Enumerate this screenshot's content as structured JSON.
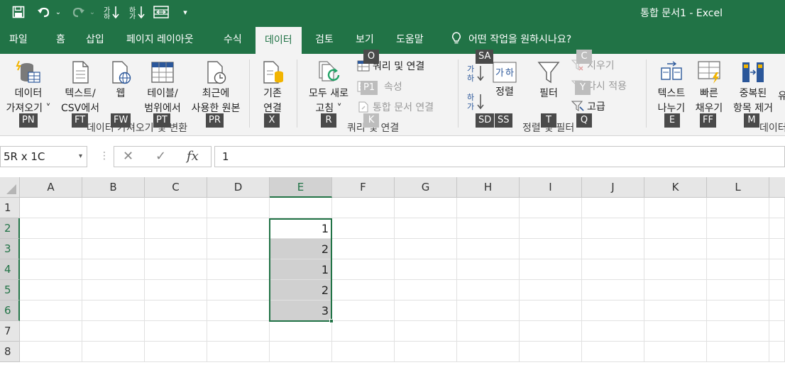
{
  "window": {
    "title": "통합 문서1  -  Excel"
  },
  "colors": {
    "accent": "#217346",
    "ribbon_bg": "#f3f3f3",
    "selection_fill": "#d0d0d0"
  },
  "qat": {
    "save_icon": "save-icon",
    "undo_icon": "undo-icon",
    "redo_icon": "redo-icon",
    "sort_asc_icon": "sort-ascending-icon",
    "sort_desc_icon": "sort-descending-icon",
    "form_icon": "form-icon",
    "more": "▾"
  },
  "tabs": [
    {
      "label": "파일"
    },
    {
      "label": "홈"
    },
    {
      "label": "삽입"
    },
    {
      "label": "페이지 레이아웃"
    },
    {
      "label": "수식"
    },
    {
      "label": "데이터"
    },
    {
      "label": "검토"
    },
    {
      "label": "보기"
    },
    {
      "label": "도움말"
    }
  ],
  "tellme": {
    "text": "어떤 작업을 원하시나요?"
  },
  "ribbon": {
    "get_data": {
      "line1": "데이터",
      "line2": "가져오기 ˅",
      "key": "PN"
    },
    "from_csv": {
      "line1": "텍스트/",
      "line2": "CSV에서",
      "key": "FT"
    },
    "from_web": {
      "line1": "웹",
      "key": "FW"
    },
    "from_table": {
      "line1": "테이블/",
      "line2": "범위에서",
      "key": "PT"
    },
    "recent_sources": {
      "line1": "최근에",
      "line2": "사용한 원본",
      "key": "PR"
    },
    "existing_conn": {
      "line1": "기존",
      "line2": "연결",
      "key": "X"
    },
    "group_get_transform": "데이터 가져오기 및 변환",
    "refresh_all": {
      "line1": "모두 새로",
      "line2": "고침 ˅",
      "key": "R"
    },
    "queries_conn": {
      "label": "쿼리 및 연결",
      "key": "O"
    },
    "properties": {
      "label": "속성",
      "key": "P1"
    },
    "edit_links": {
      "label": "통합 문서 연결",
      "key": "K"
    },
    "group_queries": "쿼리 및 연결",
    "sort_az_key": "SA",
    "sort_label": "정렬",
    "sort_keys": [
      "SD",
      "SS"
    ],
    "filter": {
      "label": "필터",
      "key": "T"
    },
    "clear": {
      "label": "지우기",
      "key": "C"
    },
    "reapply": {
      "label": "다시 적용",
      "key": "Y"
    },
    "advanced": {
      "label": "고급",
      "key": "Q"
    },
    "group_sort_filter": "정렬 및 필터",
    "text_to_cols": {
      "line1": "텍스트",
      "line2": "나누기",
      "key": "E"
    },
    "flash_fill": {
      "line1": "빠른",
      "line2": "채우기",
      "key": "FF"
    },
    "remove_dup": {
      "line1": "중복된",
      "line2": "항목 제거",
      "key": "M"
    },
    "validation_partial": "유",
    "group_data_tools": "데이터"
  },
  "formula_bar": {
    "name_box": "5R x 1C",
    "cancel": "✕",
    "enter": "✓",
    "fx": "fx",
    "content": "1"
  },
  "columns": [
    "A",
    "B",
    "C",
    "D",
    "E",
    "F",
    "G",
    "H",
    "I",
    "J",
    "K",
    "L"
  ],
  "rows": [
    {
      "n": "1",
      "e": ""
    },
    {
      "n": "2",
      "e": "1"
    },
    {
      "n": "3",
      "e": "2"
    },
    {
      "n": "4",
      "e": "1"
    },
    {
      "n": "5",
      "e": "2"
    },
    {
      "n": "6",
      "e": "3"
    },
    {
      "n": "7",
      "e": ""
    },
    {
      "n": "8",
      "e": ""
    }
  ],
  "selection": {
    "column": "E",
    "rows": [
      "2",
      "3",
      "4",
      "5",
      "6"
    ]
  }
}
